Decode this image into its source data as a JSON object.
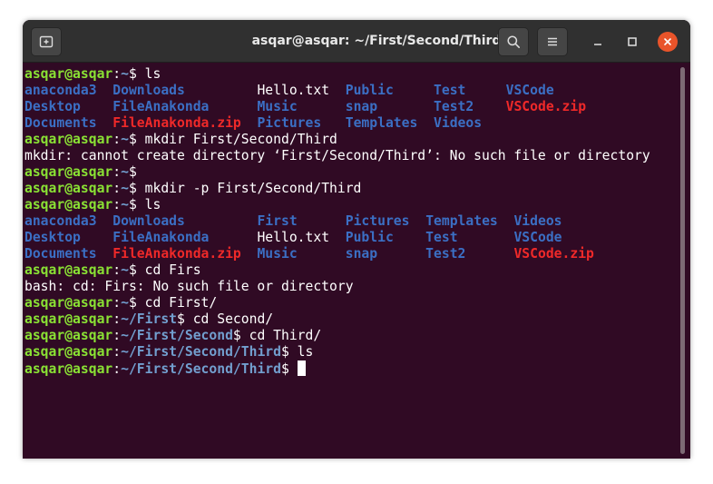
{
  "window": {
    "title": "asqar@asqar: ~/First/Second/Third",
    "icons": {
      "new_tab": "new-tab-icon",
      "search": "search-icon",
      "menu": "hamburger-menu-icon",
      "minimize": "minimize-icon",
      "maximize": "maximize-icon",
      "close": "close-icon"
    }
  },
  "colors": {
    "background": "#300a24",
    "prompt_user": "#8ae234",
    "prompt_path": "#729fcf",
    "directory": "#3b6fc4",
    "archive": "#ef2929",
    "close_button": "#e9542a"
  },
  "terminal": {
    "lines": [
      [
        [
          "asqar@asqar",
          "u"
        ],
        [
          ":",
          "f"
        ],
        [
          "~",
          "p"
        ],
        [
          "$ ls",
          "f"
        ]
      ],
      [
        [
          "anaconda3",
          "d"
        ],
        [
          "  ",
          "f"
        ],
        [
          "Downloads",
          "d"
        ],
        [
          "         Hello.txt  ",
          "f"
        ],
        [
          "Public",
          "d"
        ],
        [
          "     ",
          "f"
        ],
        [
          "Test",
          "d"
        ],
        [
          "     ",
          "f"
        ],
        [
          "VSCode",
          "d"
        ]
      ],
      [
        [
          "Desktop",
          "d"
        ],
        [
          "    ",
          "f"
        ],
        [
          "FileAnakonda",
          "d"
        ],
        [
          "      ",
          "f"
        ],
        [
          "Music",
          "d"
        ],
        [
          "      ",
          "f"
        ],
        [
          "snap",
          "d"
        ],
        [
          "       ",
          "f"
        ],
        [
          "Test2",
          "d"
        ],
        [
          "    ",
          "f"
        ],
        [
          "VSCode.zip",
          "z"
        ]
      ],
      [
        [
          "Documents",
          "d"
        ],
        [
          "  ",
          "f"
        ],
        [
          "FileAnakonda.zip",
          "z"
        ],
        [
          "  ",
          "f"
        ],
        [
          "Pictures",
          "d"
        ],
        [
          "   ",
          "f"
        ],
        [
          "Templates",
          "d"
        ],
        [
          "  ",
          "f"
        ],
        [
          "Videos",
          "d"
        ]
      ],
      [
        [
          "asqar@asqar",
          "u"
        ],
        [
          ":",
          "f"
        ],
        [
          "~",
          "p"
        ],
        [
          "$ mkdir First/Second/Third",
          "f"
        ]
      ],
      [
        [
          "mkdir: cannot create directory ‘First/Second/Third’: No such file or directory",
          "f"
        ]
      ],
      [
        [
          "asqar@asqar",
          "u"
        ],
        [
          ":",
          "f"
        ],
        [
          "~",
          "p"
        ],
        [
          "$",
          "f"
        ]
      ],
      [
        [
          "asqar@asqar",
          "u"
        ],
        [
          ":",
          "f"
        ],
        [
          "~",
          "p"
        ],
        [
          "$ mkdir -p First/Second/Third",
          "f"
        ]
      ],
      [
        [
          "asqar@asqar",
          "u"
        ],
        [
          ":",
          "f"
        ],
        [
          "~",
          "p"
        ],
        [
          "$ ls",
          "f"
        ]
      ],
      [
        [
          "anaconda3",
          "d"
        ],
        [
          "  ",
          "f"
        ],
        [
          "Downloads",
          "d"
        ],
        [
          "         ",
          "f"
        ],
        [
          "First",
          "d"
        ],
        [
          "      ",
          "f"
        ],
        [
          "Pictures",
          "d"
        ],
        [
          "  ",
          "f"
        ],
        [
          "Templates",
          "d"
        ],
        [
          "  ",
          "f"
        ],
        [
          "Videos",
          "d"
        ]
      ],
      [
        [
          "Desktop",
          "d"
        ],
        [
          "    ",
          "f"
        ],
        [
          "FileAnakonda",
          "d"
        ],
        [
          "      Hello.txt  ",
          "f"
        ],
        [
          "Public",
          "d"
        ],
        [
          "    ",
          "f"
        ],
        [
          "Test",
          "d"
        ],
        [
          "       ",
          "f"
        ],
        [
          "VSCode",
          "d"
        ]
      ],
      [
        [
          "Documents",
          "d"
        ],
        [
          "  ",
          "f"
        ],
        [
          "FileAnakonda.zip",
          "z"
        ],
        [
          "  ",
          "f"
        ],
        [
          "Music",
          "d"
        ],
        [
          "      ",
          "f"
        ],
        [
          "snap",
          "d"
        ],
        [
          "      ",
          "f"
        ],
        [
          "Test2",
          "d"
        ],
        [
          "      ",
          "f"
        ],
        [
          "VSCode.zip",
          "z"
        ]
      ],
      [
        [
          "asqar@asqar",
          "u"
        ],
        [
          ":",
          "f"
        ],
        [
          "~",
          "p"
        ],
        [
          "$ cd Firs",
          "f"
        ]
      ],
      [
        [
          "bash: cd: Firs: No such file or directory",
          "f"
        ]
      ],
      [
        [
          "asqar@asqar",
          "u"
        ],
        [
          ":",
          "f"
        ],
        [
          "~",
          "p"
        ],
        [
          "$ cd First/",
          "f"
        ]
      ],
      [
        [
          "asqar@asqar",
          "u"
        ],
        [
          ":",
          "f"
        ],
        [
          "~/First",
          "p"
        ],
        [
          "$ cd Second/",
          "f"
        ]
      ],
      [
        [
          "asqar@asqar",
          "u"
        ],
        [
          ":",
          "f"
        ],
        [
          "~/First/Second",
          "p"
        ],
        [
          "$ cd Third/",
          "f"
        ]
      ],
      [
        [
          "asqar@asqar",
          "u"
        ],
        [
          ":",
          "f"
        ],
        [
          "~/First/Second/Third",
          "p"
        ],
        [
          "$ ls",
          "f"
        ]
      ],
      [
        [
          "asqar@asqar",
          "u"
        ],
        [
          ":",
          "f"
        ],
        [
          "~/First/Second/Third",
          "p"
        ],
        [
          "$ ",
          "f"
        ]
      ]
    ]
  }
}
